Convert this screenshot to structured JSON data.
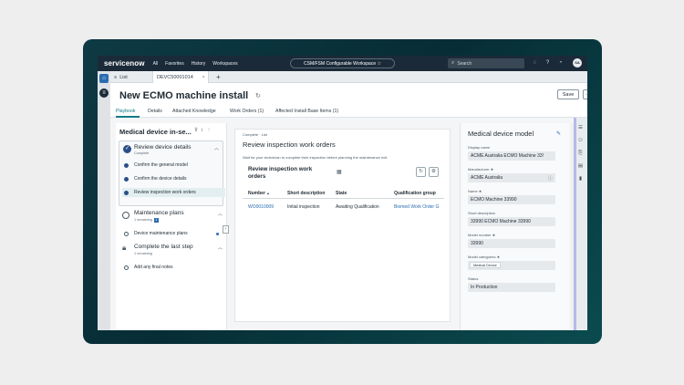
{
  "app": {
    "logo": "servicenow",
    "nav": [
      "All",
      "Favorites",
      "History",
      "Workspaces"
    ],
    "workspace": "CSM/FSM Configurable Workspace ☆",
    "search_placeholder": "Search",
    "avatar_initials": "SA"
  },
  "tabs": {
    "list_label": "List",
    "record_label": "DEVC50001014",
    "close": "×",
    "add": "+"
  },
  "record": {
    "title": "New ECMO machine install",
    "save_label": "Save",
    "more_label": "...",
    "subtabs": [
      "Playbook",
      "Details",
      "Attached Knowledge",
      "Work Orders (1)",
      "Affected Install Base Items (1)"
    ]
  },
  "playbook": {
    "title": "Medical device in-se...",
    "stage1": {
      "title": "Review device details",
      "status": "Complete",
      "tasks": [
        "Confirm the general model",
        "Confirm the device details",
        "Review inspection work orders"
      ]
    },
    "stage2": {
      "title": "Maintenance plans",
      "status": "1 remaining",
      "badge": "1",
      "tasks": [
        "Device maintenance plans"
      ]
    },
    "stage3": {
      "title": "Complete the last step",
      "status": "1 remaining",
      "tasks": [
        "Add any final notes"
      ]
    }
  },
  "inspection": {
    "breadcrumb": "Complete · List",
    "title": "Review inspection work orders",
    "description": "Wait for your technician to complete their inspection before planning the maintenance exit.",
    "related_title": "Review inspection work orders",
    "columns": [
      "Number",
      "Short description",
      "State",
      "Qualification group"
    ],
    "sort_indicator": "▲",
    "rows": [
      [
        "WO0010009",
        "Initial inspection",
        "Awaiting Qualification",
        "Biomed Work Order G"
      ]
    ]
  },
  "device_form": {
    "title": "Medical device model",
    "fields": [
      {
        "label": "Display name",
        "value": "ACME Australia ECMO Machine 33!"
      },
      {
        "label": "Manufacturer ★",
        "value": "ACME Australia"
      },
      {
        "label": "Name ★",
        "value": "ECMO Machine 33990"
      },
      {
        "label": "Short description",
        "value": "33990 ECMO Machine 33990"
      },
      {
        "label": "Model number ★",
        "value": "33990"
      },
      {
        "label": "Model categories ★",
        "value": "Medical Device"
      },
      {
        "label": "Status",
        "value": "In Production"
      }
    ]
  },
  "colors": {
    "nav_bg": "#1b2a38",
    "accent": "#0e7c86",
    "link": "#2b6cb0",
    "check": "#2b4f88",
    "frame": "#0a3640"
  }
}
